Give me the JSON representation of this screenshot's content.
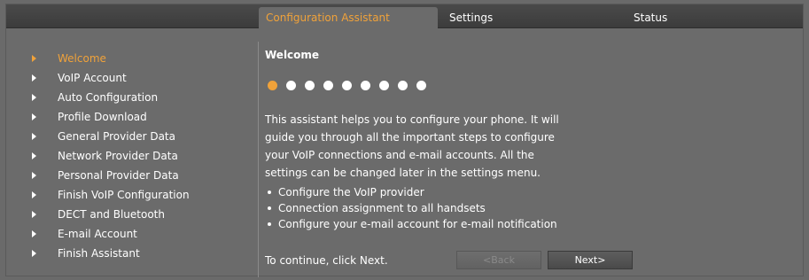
{
  "tabs": [
    {
      "label": "Configuration Assistant",
      "active": true
    },
    {
      "label": "Settings",
      "active": false
    },
    {
      "label": "Status",
      "active": false
    }
  ],
  "sidebar": {
    "items": [
      {
        "label": "Welcome",
        "active": true
      },
      {
        "label": "VoIP Account"
      },
      {
        "label": "Auto Configuration"
      },
      {
        "label": "Profile Download"
      },
      {
        "label": "General Provider Data"
      },
      {
        "label": "Network Provider Data"
      },
      {
        "label": "Personal Provider Data"
      },
      {
        "label": "Finish VoIP Configuration"
      },
      {
        "label": "DECT and Bluetooth"
      },
      {
        "label": "E-mail Account"
      },
      {
        "label": "Finish Assistant"
      }
    ]
  },
  "main": {
    "title": "Welcome",
    "progress": {
      "total_steps": 9,
      "current_step": 1
    },
    "intro": "This assistant helps you to configure your phone. It will guide you through all the important steps to configure your VoIP connections and e-mail accounts. All the settings can be changed later in the settings menu.",
    "bullets": [
      "Configure the VoIP provider",
      "Connection assignment to all handsets",
      "Configure your e-mail account for e-mail notification"
    ],
    "continue_text": "To continue, click Next.",
    "back_label": "<Back",
    "next_label": "Next>"
  },
  "colors": {
    "accent": "#f0a23a",
    "background": "#6b6b6b",
    "topbar": "#404040"
  }
}
